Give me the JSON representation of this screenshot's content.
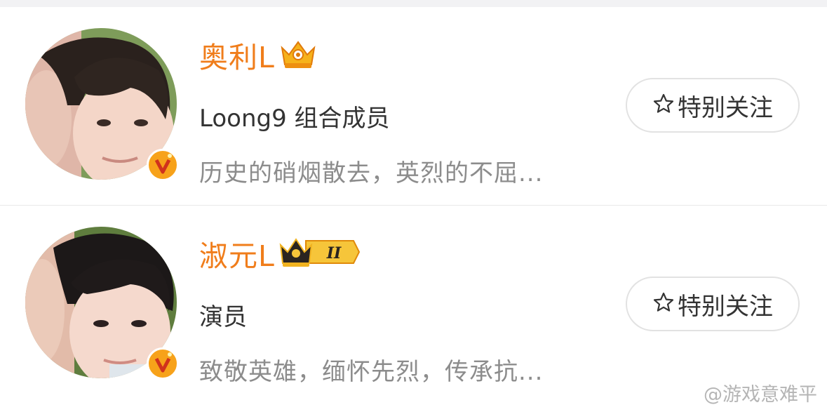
{
  "users": [
    {
      "name": "奥利L",
      "bio": "Loong9 组合成员",
      "description": "历史的硝烟散去，英烈的不屈...",
      "badge_icon": "gold-crown-icon",
      "verified_icon": "v-verified-icon",
      "follow_icon": "star-outline-icon",
      "follow_label": "特别关注"
    },
    {
      "name": "淑元L",
      "bio": "演员",
      "description": "致敬英雄，缅怀先烈，传承抗...",
      "badge_icon": "crown-level-icon",
      "badge_level": "II",
      "verified_icon": "v-verified-icon",
      "follow_icon": "star-outline-icon",
      "follow_label": "特别关注"
    }
  ],
  "watermark": "@游戏意难平",
  "colors": {
    "name": "#f07d1b",
    "bio": "#333333",
    "description": "#8c8c8c",
    "badge": "#f7a21a",
    "button_border": "#e2e2e2",
    "divider": "#e9e9e9"
  }
}
